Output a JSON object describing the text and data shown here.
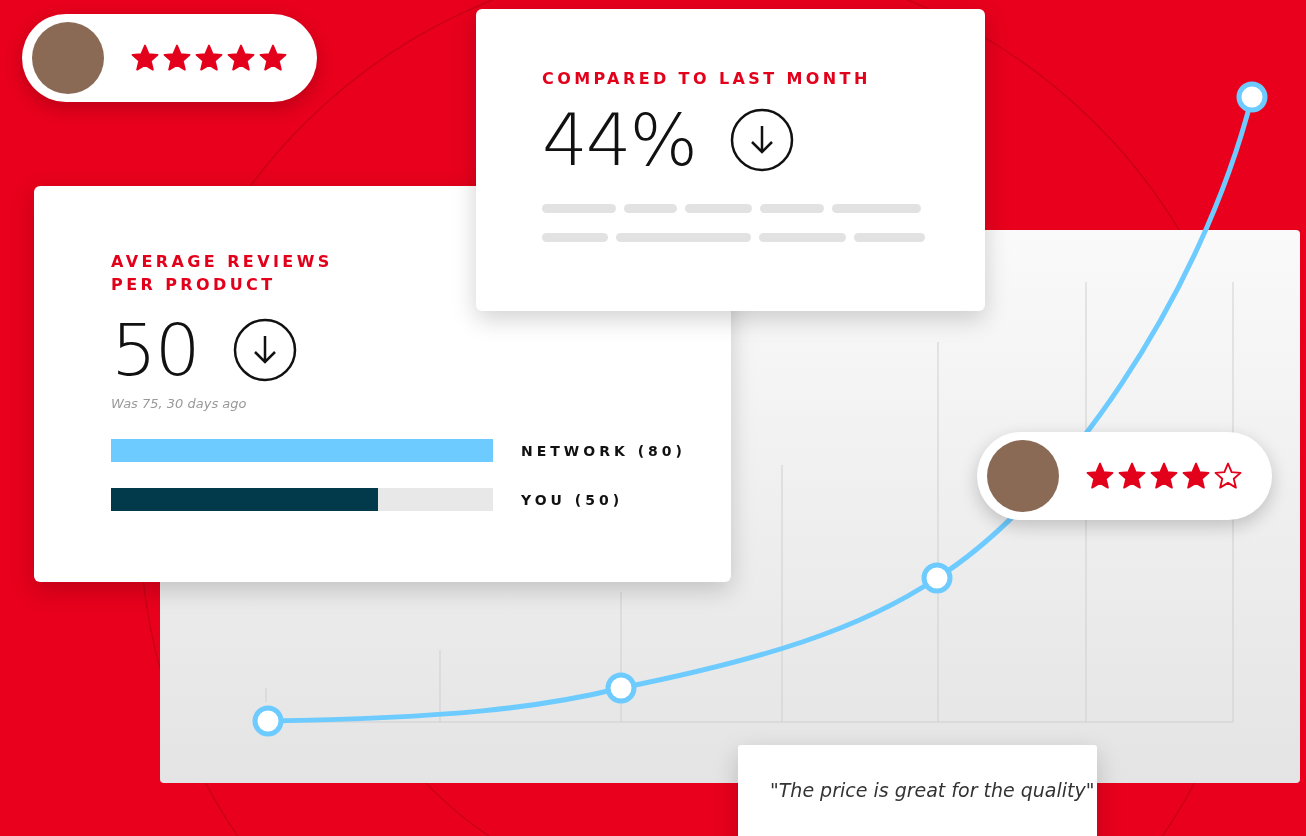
{
  "review_badges": [
    {
      "stars": 5
    },
    {
      "stars": 4
    }
  ],
  "month_card": {
    "title": "COMPARED TO LAST MONTH",
    "value": "44%"
  },
  "reviews_card": {
    "title": "AVERAGE REVIEWS PER PRODUCT",
    "value": "50",
    "note": "Was 75, 30 days ago",
    "bars": [
      {
        "label": "NETWORK (80)",
        "level": 1.0,
        "color": "#6ecbff"
      },
      {
        "label": "YOU (50)",
        "level": 0.7,
        "color": "#023a4b"
      }
    ]
  },
  "quote": {
    "text": "\"The price is great for the quality\""
  }
}
